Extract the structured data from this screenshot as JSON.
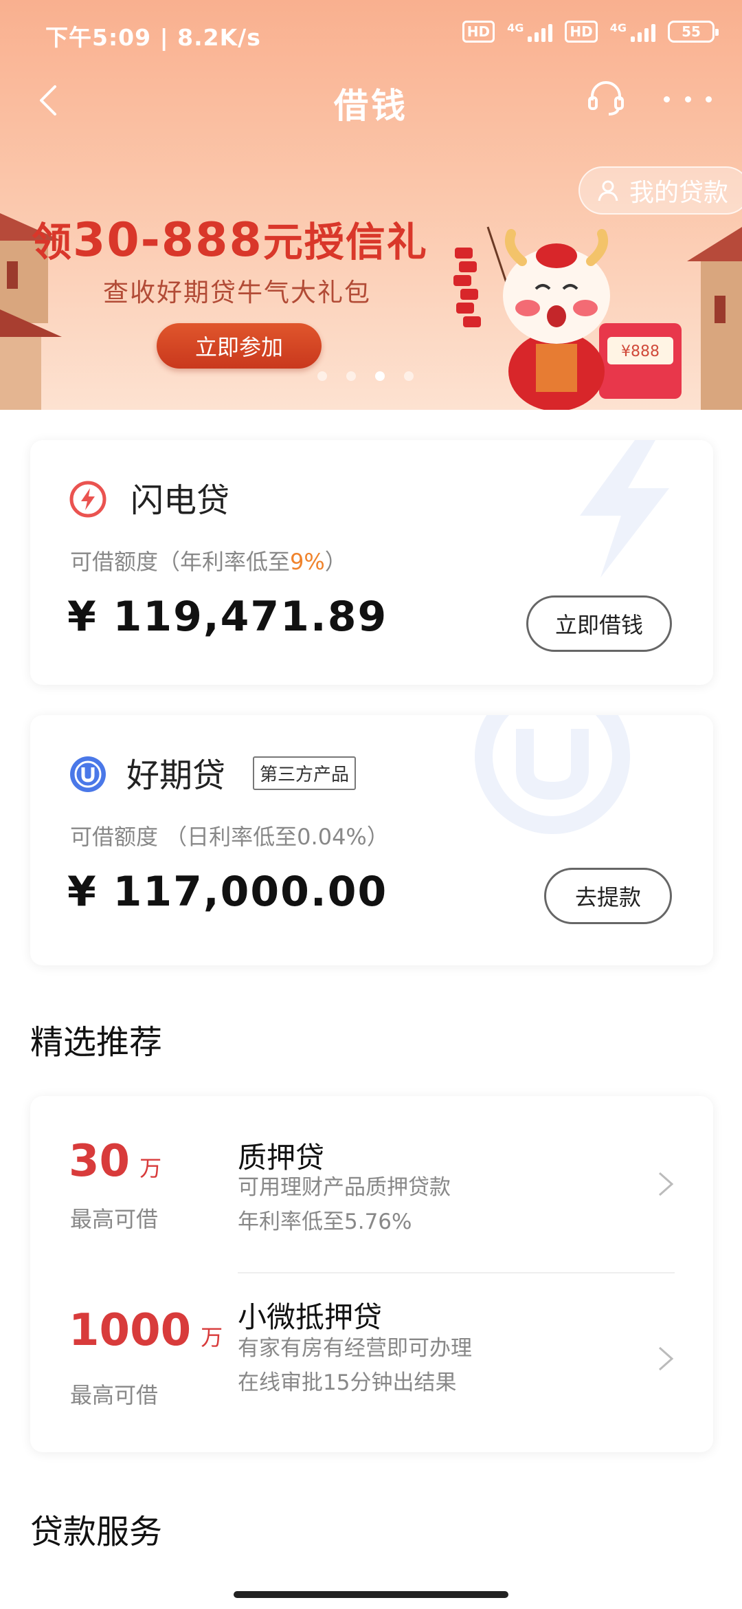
{
  "status_bar": {
    "time_speed": "下午5:09 | 8.2K/s",
    "hd_label": "HD",
    "network_label": "4G",
    "battery": "55"
  },
  "nav": {
    "title": "借钱"
  },
  "banner": {
    "my_loans_label": "我的贷款",
    "title_prefix": "领",
    "title_amount": "30-888",
    "title_suffix": "元授信礼",
    "subtitle": "查收好期贷牛气大礼包",
    "join_label": "立即参加",
    "envelope_text": "¥888",
    "slide_count": 4,
    "active_slide": 3
  },
  "loans": [
    {
      "name": "闪电贷",
      "limit_label": "可借额度（年利率低至",
      "rate": "9%",
      "limit_close": "）",
      "amount": "¥ 119,471.89",
      "button": "立即借钱"
    },
    {
      "name": "好期贷",
      "badge": "第三方产品",
      "limit_label": "可借额度 （日利率低至0.04%）",
      "amount": "¥ 117,000.00",
      "button": "去提款"
    }
  ],
  "sections": {
    "recommend": "精选推荐",
    "service": "贷款服务"
  },
  "recommendations": [
    {
      "amount": "30",
      "unit": "万",
      "amount_label": "最高可借",
      "name": "质押贷",
      "desc_1": "可用理财产品质押贷款",
      "desc_2": "年利率低至5.76%"
    },
    {
      "amount": "1000",
      "unit": "万",
      "amount_label": "最高可借",
      "name": "小微抵押贷",
      "desc_1": "有家有房有经营即可办理",
      "desc_2": "在线审批15分钟出结果"
    }
  ],
  "colors": {
    "banner_top": "#f9b08f",
    "accent_red": "#d83b3b",
    "rate_orange": "#f0832c"
  },
  "icons": {
    "back": "chevron-left-icon",
    "customer_service": "headset-icon",
    "more": "more-dots-icon",
    "user": "user-icon",
    "flash_loan": "lightning-icon",
    "haoqi_loan": "u-logo-icon",
    "arrow": "chevron-right-icon"
  }
}
